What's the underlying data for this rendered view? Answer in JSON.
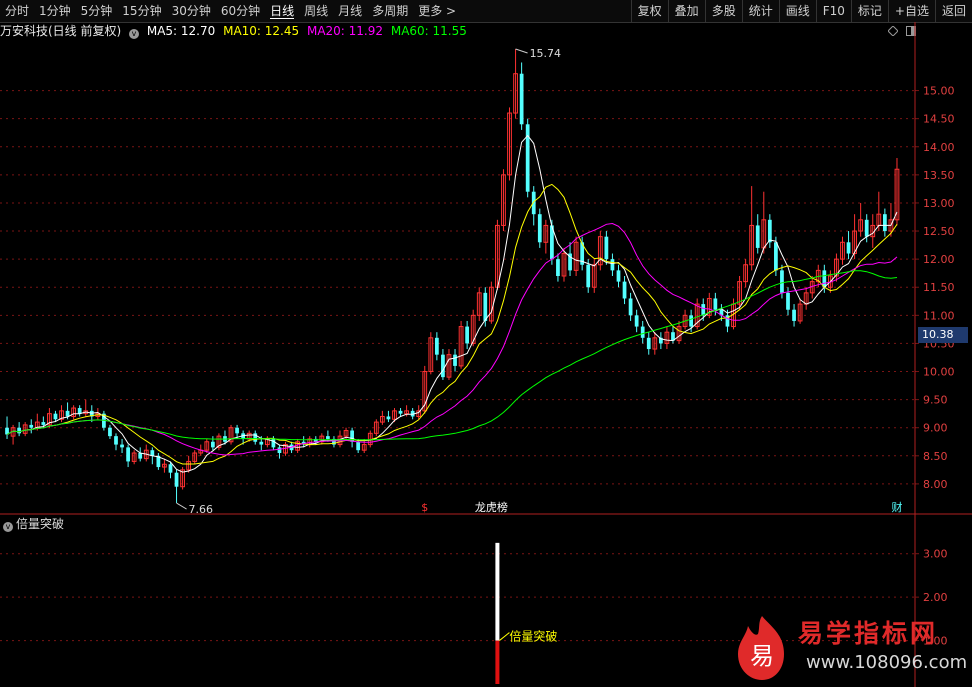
{
  "toolbar": {
    "periods": [
      {
        "label": "分时",
        "active": false
      },
      {
        "label": "1分钟",
        "active": false
      },
      {
        "label": "5分钟",
        "active": false
      },
      {
        "label": "15分钟",
        "active": false
      },
      {
        "label": "30分钟",
        "active": false
      },
      {
        "label": "60分钟",
        "active": false
      },
      {
        "label": "日线",
        "active": true
      },
      {
        "label": "周线",
        "active": false
      },
      {
        "label": "月线",
        "active": false
      },
      {
        "label": "多周期",
        "active": false
      }
    ],
    "more_label": "更多 >",
    "right_buttons": [
      "复权",
      "叠加",
      "多股",
      "统计",
      "画线",
      "F10",
      "标记",
      "+自选",
      "返回"
    ]
  },
  "info": {
    "stock_name": "万安科技(日线 前复权)",
    "ma5_label": "MA5: 12.70",
    "ma10_label": "MA10: 12.45",
    "ma20_label": "MA20: 11.92",
    "ma60_label": "MA60: 11.55"
  },
  "colors": {
    "up": "#ff3232",
    "down": "#54ffff",
    "ma5": "#ffffff",
    "ma10": "#ffff00",
    "ma20": "#ff00ff",
    "ma60": "#00ff00",
    "grid": "#7a1414",
    "axis_text": "#e04040"
  },
  "chart_data": [
    {
      "type": "candlestick",
      "y_ticks": [
        8.0,
        8.5,
        9.0,
        9.5,
        10.0,
        10.5,
        11.0,
        11.5,
        12.0,
        12.5,
        13.0,
        13.5,
        14.0,
        14.5,
        15.0
      ],
      "y_tick_labels": [
        "8.00",
        "8.50",
        "9.00",
        "9.50",
        "10.00",
        "10.50",
        "11.00",
        "11.50",
        "12.00",
        "12.50",
        "13.00",
        "13.50",
        "14.00",
        "14.50",
        "15.00"
      ],
      "ylim": [
        7.5,
        15.9
      ],
      "current_price_label": "10.38",
      "high_annotation": "15.74",
      "low_annotation": "7.66",
      "markers": [
        {
          "label": "$",
          "color": "#ff3232",
          "day": 69
        },
        {
          "label": "龙虎榜",
          "color": "#ffffff",
          "day": 80
        },
        {
          "label": "财",
          "color": "#54ffff",
          "day": 147
        }
      ],
      "candles": [
        [
          9.0,
          8.88,
          9.2,
          8.8
        ],
        [
          8.85,
          9.0,
          9.05,
          8.7
        ],
        [
          9.0,
          8.9,
          9.1,
          8.85
        ],
        [
          8.9,
          9.05,
          9.1,
          8.85
        ],
        [
          9.05,
          9.0,
          9.15,
          8.9
        ],
        [
          9.0,
          9.1,
          9.25,
          8.95
        ],
        [
          9.1,
          9.05,
          9.2,
          9.0
        ],
        [
          9.05,
          9.25,
          9.35,
          9.0
        ],
        [
          9.25,
          9.15,
          9.3,
          9.1
        ],
        [
          9.15,
          9.3,
          9.4,
          9.1
        ],
        [
          9.3,
          9.2,
          9.45,
          9.15
        ],
        [
          9.2,
          9.35,
          9.4,
          9.15
        ],
        [
          9.35,
          9.25,
          9.4,
          9.2
        ],
        [
          9.25,
          9.3,
          9.5,
          9.2
        ],
        [
          9.3,
          9.2,
          9.4,
          9.1
        ],
        [
          9.2,
          9.25,
          9.35,
          9.15
        ],
        [
          9.25,
          9.0,
          9.3,
          8.95
        ],
        [
          9.0,
          8.85,
          9.05,
          8.8
        ],
        [
          8.85,
          8.7,
          8.9,
          8.6
        ],
        [
          8.7,
          8.65,
          8.8,
          8.55
        ],
        [
          8.65,
          8.4,
          8.7,
          8.3
        ],
        [
          8.4,
          8.55,
          8.6,
          8.35
        ],
        [
          8.55,
          8.45,
          8.65,
          8.4
        ],
        [
          8.45,
          8.6,
          8.7,
          8.4
        ],
        [
          8.6,
          8.5,
          8.65,
          8.35
        ],
        [
          8.5,
          8.3,
          8.55,
          8.25
        ],
        [
          8.3,
          8.35,
          8.45,
          8.2
        ],
        [
          8.35,
          8.2,
          8.4,
          8.1
        ],
        [
          8.2,
          7.95,
          8.25,
          7.66
        ],
        [
          7.95,
          8.25,
          8.3,
          7.9
        ],
        [
          8.25,
          8.4,
          8.5,
          8.2
        ],
        [
          8.4,
          8.55,
          8.6,
          8.35
        ],
        [
          8.55,
          8.6,
          8.7,
          8.5
        ],
        [
          8.6,
          8.75,
          8.8,
          8.55
        ],
        [
          8.75,
          8.65,
          8.85,
          8.6
        ],
        [
          8.65,
          8.85,
          8.9,
          8.6
        ],
        [
          8.85,
          8.75,
          8.95,
          8.7
        ],
        [
          8.75,
          9.0,
          9.05,
          8.7
        ],
        [
          9.0,
          8.9,
          9.05,
          8.8
        ],
        [
          8.9,
          8.8,
          8.95,
          8.7
        ],
        [
          8.8,
          8.9,
          8.95,
          8.75
        ],
        [
          8.9,
          8.75,
          8.95,
          8.7
        ],
        [
          8.75,
          8.7,
          8.85,
          8.6
        ],
        [
          8.7,
          8.8,
          8.85,
          8.65
        ],
        [
          8.8,
          8.65,
          8.85,
          8.6
        ],
        [
          8.65,
          8.55,
          8.7,
          8.45
        ],
        [
          8.55,
          8.7,
          8.75,
          8.5
        ],
        [
          8.7,
          8.6,
          8.75,
          8.55
        ],
        [
          8.6,
          8.75,
          8.8,
          8.55
        ],
        [
          8.75,
          8.7,
          8.85,
          8.65
        ],
        [
          8.7,
          8.8,
          8.85,
          8.65
        ],
        [
          8.8,
          8.75,
          8.85,
          8.7
        ],
        [
          8.75,
          8.85,
          8.9,
          8.7
        ],
        [
          8.85,
          8.8,
          8.95,
          8.75
        ],
        [
          8.8,
          8.7,
          8.85,
          8.65
        ],
        [
          8.7,
          8.85,
          8.95,
          8.65
        ],
        [
          8.85,
          8.95,
          9.0,
          8.8
        ],
        [
          8.95,
          8.75,
          9.0,
          8.65
        ],
        [
          8.75,
          8.6,
          8.8,
          8.55
        ],
        [
          8.6,
          8.7,
          8.8,
          8.55
        ],
        [
          8.7,
          8.9,
          8.95,
          8.65
        ],
        [
          8.9,
          9.1,
          9.15,
          8.85
        ],
        [
          9.1,
          9.2,
          9.3,
          9.05
        ],
        [
          9.2,
          9.15,
          9.3,
          9.1
        ],
        [
          9.15,
          9.3,
          9.35,
          9.1
        ],
        [
          9.3,
          9.25,
          9.35,
          9.2
        ],
        [
          9.25,
          9.3,
          9.4,
          9.2
        ],
        [
          9.3,
          9.2,
          9.35,
          9.15
        ],
        [
          9.2,
          9.3,
          9.4,
          9.15
        ],
        [
          9.3,
          10.0,
          10.1,
          9.25
        ],
        [
          10.0,
          10.6,
          10.7,
          9.95
        ],
        [
          10.6,
          10.3,
          10.7,
          10.2
        ],
        [
          10.3,
          9.9,
          10.4,
          9.85
        ],
        [
          9.9,
          10.3,
          10.4,
          9.85
        ],
        [
          10.3,
          10.1,
          10.4,
          10.0
        ],
        [
          10.1,
          10.8,
          10.9,
          10.05
        ],
        [
          10.8,
          10.5,
          10.9,
          10.4
        ],
        [
          10.5,
          11.0,
          11.1,
          10.45
        ],
        [
          11.0,
          11.4,
          11.5,
          10.9
        ],
        [
          11.4,
          10.9,
          11.5,
          10.8
        ],
        [
          10.9,
          11.5,
          11.6,
          10.85
        ],
        [
          11.5,
          12.6,
          12.7,
          11.45
        ],
        [
          12.6,
          13.5,
          13.6,
          12.5
        ],
        [
          13.5,
          14.6,
          14.7,
          13.4
        ],
        [
          14.6,
          15.3,
          15.74,
          14.5
        ],
        [
          15.3,
          14.4,
          15.5,
          14.3
        ],
        [
          14.4,
          13.2,
          14.5,
          13.1
        ],
        [
          13.2,
          12.8,
          13.3,
          12.6
        ],
        [
          12.8,
          12.3,
          12.9,
          12.2
        ],
        [
          12.3,
          12.6,
          12.7,
          12.1
        ],
        [
          12.6,
          12.0,
          12.7,
          11.9
        ],
        [
          12.0,
          11.7,
          12.1,
          11.6
        ],
        [
          11.7,
          12.1,
          12.2,
          11.6
        ],
        [
          12.1,
          11.8,
          12.3,
          11.7
        ],
        [
          11.8,
          12.3,
          12.4,
          11.7
        ],
        [
          12.3,
          11.9,
          12.4,
          11.8
        ],
        [
          11.9,
          11.5,
          12.0,
          11.4
        ],
        [
          11.5,
          11.9,
          12.0,
          11.4
        ],
        [
          11.9,
          12.4,
          12.5,
          11.8
        ],
        [
          12.4,
          12.0,
          12.5,
          11.9
        ],
        [
          12.0,
          11.8,
          12.1,
          11.7
        ],
        [
          11.8,
          11.6,
          11.9,
          11.5
        ],
        [
          11.6,
          11.3,
          11.7,
          11.2
        ],
        [
          11.3,
          11.0,
          11.4,
          10.9
        ],
        [
          11.0,
          10.8,
          11.1,
          10.7
        ],
        [
          10.8,
          10.6,
          10.9,
          10.5
        ],
        [
          10.6,
          10.4,
          10.7,
          10.3
        ],
        [
          10.4,
          10.6,
          10.7,
          10.3
        ],
        [
          10.6,
          10.5,
          10.7,
          10.4
        ],
        [
          10.5,
          10.7,
          10.8,
          10.4
        ],
        [
          10.7,
          10.55,
          10.8,
          10.5
        ],
        [
          10.55,
          10.8,
          10.9,
          10.5
        ],
        [
          10.8,
          11.0,
          11.1,
          10.75
        ],
        [
          11.0,
          10.8,
          11.1,
          10.7
        ],
        [
          10.8,
          11.2,
          11.3,
          10.75
        ],
        [
          11.2,
          11.0,
          11.3,
          10.9
        ],
        [
          11.0,
          11.3,
          11.4,
          10.95
        ],
        [
          11.3,
          11.1,
          11.4,
          11.0
        ],
        [
          11.1,
          11.0,
          11.2,
          10.9
        ],
        [
          11.0,
          10.8,
          11.1,
          10.7
        ],
        [
          10.8,
          11.2,
          11.3,
          10.75
        ],
        [
          11.2,
          11.6,
          11.7,
          11.1
        ],
        [
          11.6,
          11.9,
          12.0,
          11.5
        ],
        [
          11.9,
          12.6,
          13.3,
          11.8
        ],
        [
          12.6,
          12.2,
          12.8,
          12.1
        ],
        [
          12.2,
          12.7,
          13.2,
          12.1
        ],
        [
          12.7,
          12.3,
          12.8,
          12.2
        ],
        [
          12.3,
          11.8,
          12.4,
          11.7
        ],
        [
          11.8,
          11.4,
          11.9,
          11.3
        ],
        [
          11.4,
          11.1,
          11.5,
          11.0
        ],
        [
          11.1,
          10.9,
          11.2,
          10.8
        ],
        [
          10.9,
          11.2,
          11.3,
          10.85
        ],
        [
          11.2,
          11.4,
          11.5,
          11.1
        ],
        [
          11.4,
          11.6,
          11.7,
          11.3
        ],
        [
          11.6,
          11.8,
          11.9,
          11.5
        ],
        [
          11.8,
          11.5,
          11.9,
          11.4
        ],
        [
          11.5,
          11.7,
          11.8,
          11.4
        ],
        [
          11.7,
          12.0,
          12.1,
          11.6
        ],
        [
          12.0,
          12.3,
          12.4,
          11.9
        ],
        [
          12.3,
          12.1,
          12.5,
          12.0
        ],
        [
          12.1,
          12.5,
          12.8,
          12.0
        ],
        [
          12.5,
          12.7,
          13.0,
          12.4
        ],
        [
          12.7,
          12.4,
          12.8,
          12.3
        ],
        [
          12.4,
          12.6,
          12.8,
          12.2
        ],
        [
          12.6,
          12.8,
          13.2,
          12.5
        ],
        [
          12.8,
          12.5,
          12.9,
          12.4
        ],
        [
          12.5,
          12.7,
          13.0,
          12.4
        ],
        [
          12.7,
          13.6,
          13.8,
          12.6
        ]
      ]
    },
    {
      "type": "bar",
      "title": "倍量突破",
      "y_ticks": [
        1.0,
        2.0,
        3.0
      ],
      "y_tick_labels": [
        "1.00",
        "2.00",
        "3.00"
      ],
      "ylim": [
        0,
        3.5
      ],
      "bars": [
        {
          "day": 81,
          "value": 3.25,
          "lower_value": 1.0,
          "label": "倍量突破"
        }
      ]
    }
  ],
  "watermark": {
    "logo_char": "易",
    "title": "易学指标网",
    "url": "www.108096.com"
  }
}
